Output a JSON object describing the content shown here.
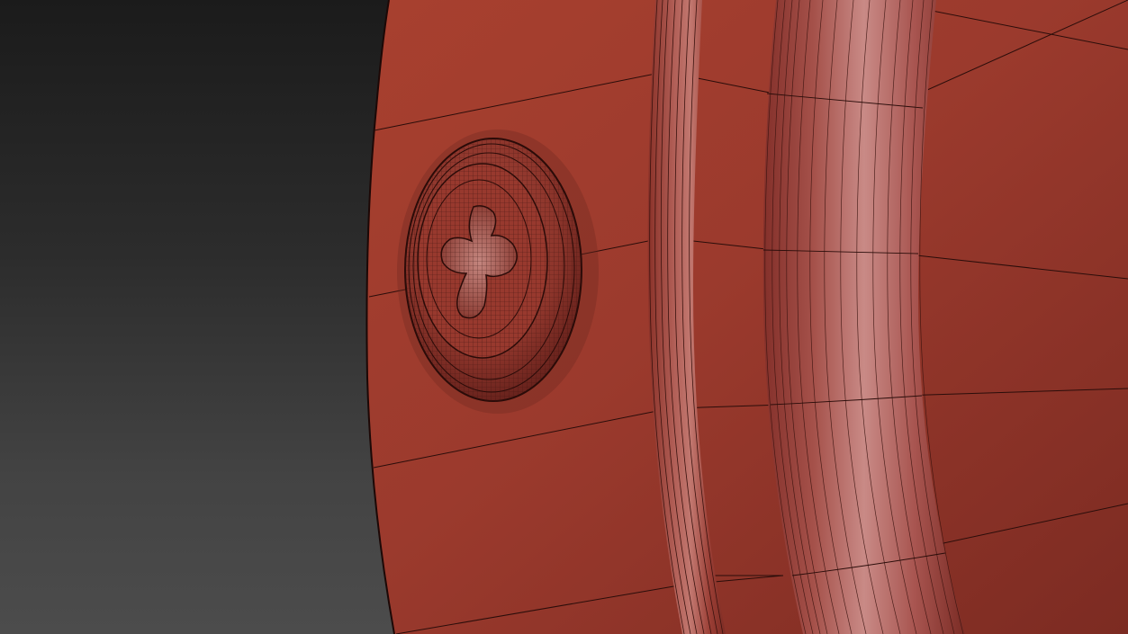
{
  "viewport": {
    "background_top": "#1b1b1b",
    "background_bottom": "#4c4c4c"
  },
  "model": {
    "body_color": "#a33b2f",
    "body_shadow_color": "#7e2a22",
    "ridge_highlight_color": "#c77a74",
    "wire_color": "#2a0d0a",
    "screw_head": "phillips",
    "display_mode": "wireframe-on-shaded"
  }
}
